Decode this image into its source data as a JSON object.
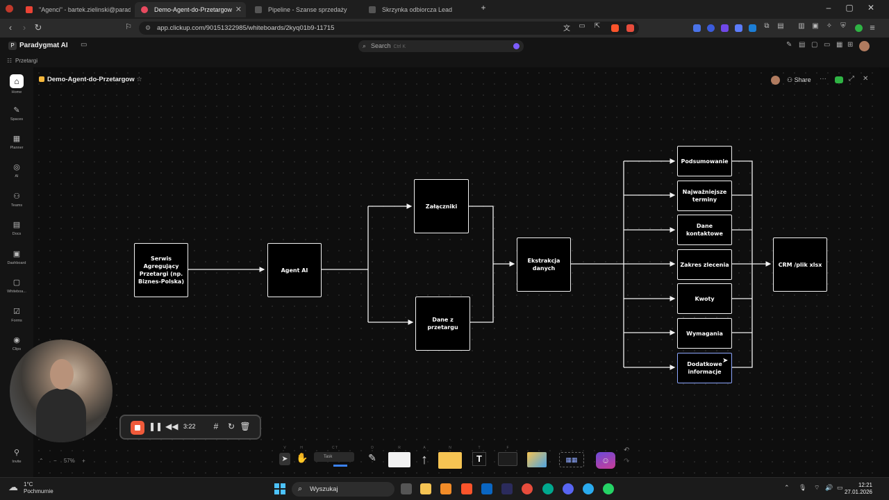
{
  "browser": {
    "tabs": [
      {
        "label": "\"Agenci\" - bartek.zielinski@paradygm",
        "favicon_color": "#ea4335"
      },
      {
        "label": "Demo-Agent-do-Przetargow",
        "favicon_color": "#e84a5f",
        "active": true
      },
      {
        "label": "Pipeline - Szanse sprzedaży",
        "favicon_color": "#555555"
      },
      {
        "label": "Skrzynka odbiorcza Lead",
        "favicon_color": "#555555"
      }
    ],
    "new_tab": "+",
    "window_controls": [
      "–",
      "▢",
      "✕"
    ],
    "url": "app.clickup.com/90151322985/whiteboards/2kyq01b9-11715"
  },
  "clickup": {
    "workspace": "Paradygmat AI",
    "workspace_initial": "P",
    "search_placeholder": "Search",
    "search_hint": "Ctrl K",
    "breadcrumb": "Przetargi",
    "whiteboard_title": "Demo-Agent-do-Przetargow",
    "share_label": "Share"
  },
  "sidebar": [
    {
      "label": "Home",
      "icon": "⌂"
    },
    {
      "label": "Spaces",
      "icon": "✎"
    },
    {
      "label": "Planner",
      "icon": "▦"
    },
    {
      "label": "AI",
      "icon": "◎"
    },
    {
      "label": "Teams",
      "icon": "⚇"
    },
    {
      "label": "Docs",
      "icon": "▤"
    },
    {
      "label": "Dashboard",
      "icon": "▣"
    },
    {
      "label": "Whiteboa...",
      "icon": "▢"
    },
    {
      "label": "Forms",
      "icon": "☑"
    },
    {
      "label": "Clips",
      "icon": "◉"
    },
    {
      "label": "Invite",
      "icon": "⚲"
    }
  ],
  "diagram": {
    "nodes": {
      "serwis": "Serwis Agregujący Przetargi (np. Biznes-Polska)",
      "agent": "Agent AI",
      "zalaczniki": "Załączniki",
      "dane_przetargu": "Dane z przetargu",
      "ekstrakcja": "Ekstrakcja danych",
      "podsumowanie": "Podsumowanie",
      "terminy": "Najważniejsze terminy",
      "kontakt": "Dane kontaktowe",
      "zakres": "Zakres zlecenia",
      "kwoty": "Kwoty",
      "wymagania": "Wymagania",
      "dodatkowe": "Dodatkowe informacje",
      "crm": "CRM /plik xlsx"
    }
  },
  "recorder": {
    "time": "3:22"
  },
  "toolbar": {
    "zoom": "57%",
    "task_label": "Task",
    "shortcuts": [
      "V",
      "H",
      "C T",
      "D",
      "R",
      "A",
      "N",
      "T",
      "F"
    ]
  },
  "taskbar": {
    "temperature": "1°C",
    "weather_text": "Pochmurnie",
    "search_placeholder": "Wyszukaj",
    "time": "12:21",
    "date": "27.01.2026"
  }
}
